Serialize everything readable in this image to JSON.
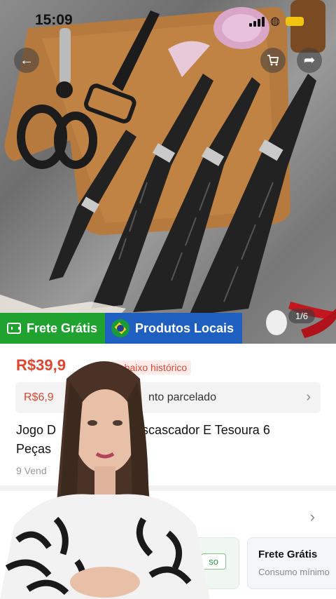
{
  "status_bar": {
    "time": "15:09"
  },
  "gallery": {
    "counter": "1/6"
  },
  "badges": {
    "free_shipping": "Frete Grátis",
    "local_products": "Produtos Locais"
  },
  "product": {
    "price": "R$39,9",
    "price_tag": "a baixo histórico",
    "installment_amount": "R$6,9",
    "installment_text": "nto parcelado",
    "title_line1": "Jogo D                    Descascador E Tesoura 6",
    "title_line2": "Peças",
    "sold": "9 Vend"
  },
  "coupons": {
    "card1_label": "Co",
    "card1_button": "so",
    "card2_title": "Frete Grátis",
    "card2_subtitle": "Consumo mínimo"
  },
  "colors": {
    "accent_red": "#e0462f",
    "green_badge": "#1fa22f",
    "blue_badge": "#1f5fbf"
  }
}
